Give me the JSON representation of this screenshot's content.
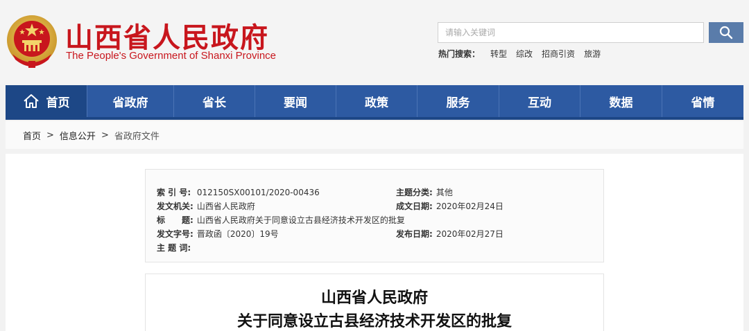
{
  "header": {
    "title": "山西省人民政府",
    "subtitle": "The People's Government of Shanxi Province",
    "emblem_icon": "national-emblem-icon"
  },
  "search": {
    "placeholder": "请输入关键词",
    "button_icon": "search-icon",
    "hot_label": "热门搜索：",
    "hot_links": [
      "转型",
      "综改",
      "招商引资",
      "旅游"
    ]
  },
  "nav": {
    "items": [
      "首页",
      "省政府",
      "省长",
      "要闻",
      "政策",
      "服务",
      "互动",
      "数据",
      "省情"
    ],
    "home_icon": "home-icon"
  },
  "breadcrumb": {
    "items": [
      "首页",
      "信息公开",
      "省政府文件"
    ],
    "separator": ">"
  },
  "meta": {
    "index_label": "索 引 号:",
    "index_value": "012150SX00101/2020-00436",
    "topic_label": "主题分类:",
    "topic_value": "其他",
    "issuer_label": "发文机关:",
    "issuer_value": "山西省人民政府",
    "created_label": "成文日期:",
    "created_value": "2020年02月24日",
    "title_label": "标　　题:",
    "title_value": "山西省人民政府关于同意设立古县经济技术开发区的批复",
    "docno_label": "发文字号:",
    "docno_value": "晋政函〔2020〕19号",
    "published_label": "发布日期:",
    "published_value": "2020年02月27日",
    "keywords_label": "主 题 词:",
    "keywords_value": ""
  },
  "document": {
    "title_line1": "山西省人民政府",
    "title_line2": "关于同意设立古县经济技术开发区的批复"
  },
  "colors": {
    "brand_red": "#c8161d",
    "nav_blue": "#2d5aa2",
    "nav_active": "#1d4786",
    "search_button": "#5a7caa"
  }
}
